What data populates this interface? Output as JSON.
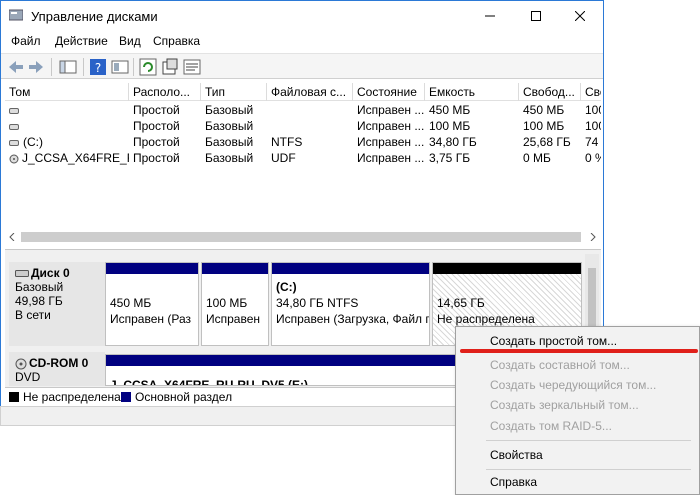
{
  "window": {
    "title": "Управление дисками"
  },
  "menu": {
    "items": [
      "Файл",
      "Действие",
      "Вид",
      "Справка"
    ]
  },
  "toolbar": {
    "icons": [
      "back-icon",
      "forward-icon",
      "console-tree-icon",
      "help-icon",
      "properties-icon",
      "refresh-icon",
      "settings-icon",
      "view-icon"
    ]
  },
  "volumes": {
    "headers": [
      "Том",
      "Располо...",
      "Тип",
      "Файловая с...",
      "Состояние",
      "Емкость",
      "Свобод...",
      "Сво"
    ],
    "rows": [
      [
        "",
        "Простой",
        "Базовый",
        "",
        "Исправен ...",
        "450 МБ",
        "450 МБ",
        "100"
      ],
      [
        "",
        "Простой",
        "Базовый",
        "",
        "Исправен ...",
        "100 МБ",
        "100 МБ",
        "100"
      ],
      [
        "(C:)",
        "Простой",
        "Базовый",
        "NTFS",
        "Исправен ...",
        "34,80 ГБ",
        "25,68 ГБ",
        "74"
      ],
      [
        "J_CCSA_X64FRE_R...",
        "Простой",
        "Базовый",
        "UDF",
        "Исправен ...",
        "3,75 ГБ",
        "0 МБ",
        "0 %"
      ]
    ]
  },
  "disks": {
    "disk0": {
      "name": "Диск 0",
      "type": "Базовый",
      "size": "49,98 ГБ",
      "state": "В сети"
    },
    "cdrom0": {
      "name": "CD-ROM 0",
      "type": "DVD"
    }
  },
  "partitions": {
    "p1": {
      "size": "450 МБ",
      "status": "Исправен (Раз"
    },
    "p2": {
      "size": "100 МБ",
      "status": "Исправен"
    },
    "p3": {
      "name": "(C:)",
      "size": "34,80 ГБ NTFS",
      "status": "Исправен (Загрузка, Файл г"
    },
    "p4": {
      "size": "14,65 ГБ",
      "status": "Не распределена"
    },
    "cd": {
      "label": "J_CCSA_X64FRE_RU-RU_DV5 (E:)"
    }
  },
  "legend": {
    "unallocated": "Не распределена",
    "primary": "Основной раздел"
  },
  "context_menu": {
    "create_simple": "Создать простой том...",
    "create_spanned": "Создать составной том...",
    "create_striped": "Создать чередующийся том...",
    "create_mirrored": "Создать зеркальный том...",
    "create_raid5": "Создать том RAID-5...",
    "properties": "Свойства",
    "help": "Справка"
  },
  "colors": {
    "primary": "#000080",
    "unallocated": "#000000",
    "highlight": "#e0201a"
  }
}
